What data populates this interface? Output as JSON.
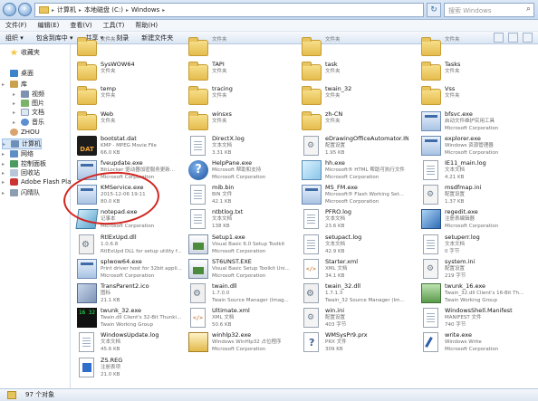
{
  "addressbar": {
    "crumbs": [
      "计算机",
      "本地磁盘 (C:)",
      "Windows"
    ],
    "search_placeholder": "搜索 Windows"
  },
  "menubar": [
    "文件(F)",
    "编辑(E)",
    "查看(V)",
    "工具(T)",
    "帮助(H)"
  ],
  "cmdbar": [
    "组织 ▾",
    "包含到库中 ▾",
    "共享 ▾",
    "刻录",
    "新建文件夹"
  ],
  "nav": [
    {
      "label": "收藏夹",
      "icon": "star-icon"
    },
    {
      "label": "桌面",
      "icon": "desktop-icon"
    },
    {
      "label": "库",
      "icon": "library-icon"
    },
    {
      "label": "视频",
      "icon": "video-icon"
    },
    {
      "label": "图片",
      "icon": "picture-icon"
    },
    {
      "label": "文档",
      "icon": "document-icon"
    },
    {
      "label": "音乐",
      "icon": "music-icon"
    },
    {
      "label": "ZHOU",
      "icon": "user-icon"
    },
    {
      "label": "计算机",
      "icon": "computer-icon"
    },
    {
      "label": "网络",
      "icon": "network-icon"
    },
    {
      "label": "控制面板",
      "icon": "control-panel-icon"
    },
    {
      "label": "回收站",
      "icon": "recycle-bin-icon"
    },
    {
      "label": "Adobe Flash Playe",
      "icon": "flash-icon"
    },
    {
      "label": "闪晴队",
      "icon": "drive-icon"
    }
  ],
  "files": [
    {
      "name": "",
      "line2": "文件夹",
      "line3": "",
      "icon": "folder-icon"
    },
    {
      "name": "",
      "line2": "文件夹",
      "line3": "",
      "icon": "folder-icon"
    },
    {
      "name": "",
      "line2": "文件夹",
      "line3": "",
      "icon": "folder-icon"
    },
    {
      "name": "",
      "line2": "文件夹",
      "line3": "",
      "icon": "folder-icon"
    },
    {
      "name": "SysWOW64",
      "line2": "文件夹",
      "line3": "",
      "icon": "folder-icon"
    },
    {
      "name": "TAPI",
      "line2": "文件夹",
      "line3": "",
      "icon": "folder-icon"
    },
    {
      "name": "task",
      "line2": "文件夹",
      "line3": "",
      "icon": "folder-icon"
    },
    {
      "name": "Tasks",
      "line2": "文件夹",
      "line3": "",
      "icon": "folder-icon"
    },
    {
      "name": "temp",
      "line2": "文件夹",
      "line3": "",
      "icon": "folder-icon"
    },
    {
      "name": "tracing",
      "line2": "文件夹",
      "line3": "",
      "icon": "folder-icon"
    },
    {
      "name": "twain_32",
      "line2": "文件夹",
      "line3": "",
      "icon": "folder-icon"
    },
    {
      "name": "Vss",
      "line2": "文件夹",
      "line3": "",
      "icon": "folder-icon"
    },
    {
      "name": "Web",
      "line2": "文件夹",
      "line3": "",
      "icon": "folder-icon"
    },
    {
      "name": "winsxs",
      "line2": "文件夹",
      "line3": "",
      "icon": "folder-icon"
    },
    {
      "name": "zh-CN",
      "line2": "文件夹",
      "line3": "",
      "icon": "folder-icon"
    },
    {
      "name": "bfsvc.exe",
      "line2": "启动文件维护实用工具",
      "line3": "Microsoft Corporation",
      "icon": "exe-icon"
    },
    {
      "name": "bootstat.dat",
      "line2": "KMP - MPEG Movie File",
      "line3": "66.0 KB",
      "icon": "dat-icon"
    },
    {
      "name": "DirectX.log",
      "line2": "文本文档",
      "line3": "3.31 KB",
      "icon": "text-file-icon"
    },
    {
      "name": "eDrawingOfficeAutomator.INI",
      "line2": "配置设置",
      "line3": "1.95 KB",
      "icon": "ini-icon"
    },
    {
      "name": "explorer.exe",
      "line2": "Windows 资源管理器",
      "line3": "Microsoft Corporation",
      "icon": "explorer-icon"
    },
    {
      "name": "fveupdate.exe",
      "line2": "BitLocker 驱动器加密服务更新...",
      "line3": "Microsoft Corporation",
      "icon": "exe-icon"
    },
    {
      "name": "HelpPane.exe",
      "line2": "Microsoft 帮助和支持",
      "line3": "Microsoft Corporation",
      "icon": "help-icon"
    },
    {
      "name": "hh.exe",
      "line2": "Microsoft® HTML 帮助可执行文件",
      "line3": "Microsoft Corporation",
      "icon": "help-file-icon"
    },
    {
      "name": "IE11_main.log",
      "line2": "文本文档",
      "line3": "4.21 KB",
      "icon": "text-file-icon"
    },
    {
      "name": "KMService.exe",
      "line2": "2015-12-06 19:11",
      "line3": "80.0 KB",
      "icon": "exe-icon"
    },
    {
      "name": "mib.bin",
      "line2": "BIN 文件",
      "line3": "42.1 KB",
      "icon": "bin-file-icon"
    },
    {
      "name": "MS_FM.exe",
      "line2": "Microsoft® Flash Working Set...",
      "line3": "Microsoft Corporation",
      "icon": "exe-icon"
    },
    {
      "name": "msdfmap.ini",
      "line2": "配置设置",
      "line3": "1.37 KB",
      "icon": "ini-icon"
    },
    {
      "name": "notepad.exe",
      "line2": "记事本",
      "line3": "Microsoft Corporation",
      "icon": "notepad-icon"
    },
    {
      "name": "ntbtlog.txt",
      "line2": "文本文档",
      "line3": "138 KB",
      "icon": "text-file-icon"
    },
    {
      "name": "PFRO.log",
      "line2": "文本文档",
      "line3": "23.6 KB",
      "icon": "text-file-icon"
    },
    {
      "name": "regedit.exe",
      "line2": "注册表编辑器",
      "line3": "Microsoft Corporation",
      "icon": "regedit-icon"
    },
    {
      "name": "RtlExUpd.dll",
      "line2": "1.0.6.8",
      "line3": "RtlExUpd DLL for setup utility f...",
      "icon": "dll-icon"
    },
    {
      "name": "Setup1.exe",
      "line2": "Visual Basic 6.0 Setup Toolkit",
      "line3": "Microsoft Corporation",
      "icon": "setup-icon"
    },
    {
      "name": "setupact.log",
      "line2": "文本文档",
      "line3": "42.9 KB",
      "icon": "text-file-icon"
    },
    {
      "name": "setuperr.log",
      "line2": "文本文档",
      "line3": "0 字节",
      "icon": "text-file-icon"
    },
    {
      "name": "splwow64.exe",
      "line2": "Print driver host for 32bit appli...",
      "line3": "Microsoft Corporation",
      "icon": "exe-icon"
    },
    {
      "name": "ST6UNST.EXE",
      "line2": "Visual Basic Setup Toolkit Uni...",
      "line3": "Microsoft Corporation",
      "icon": "setup-icon"
    },
    {
      "name": "Starter.xml",
      "line2": "XML 文档",
      "line3": "34.1 KB",
      "icon": "xml-icon"
    },
    {
      "name": "system.ini",
      "line2": "配置设置",
      "line3": "219 字节",
      "icon": "ini-icon"
    },
    {
      "name": "TransParent2.ico",
      "line2": "图标",
      "line3": "21.1 KB",
      "icon": "ico-file-icon"
    },
    {
      "name": "twain.dll",
      "line2": "1.7.0.0",
      "line3": "Twain Source Manager (Imag...",
      "icon": "dll-icon"
    },
    {
      "name": "twain_32.dll",
      "line2": "1.7.1.3",
      "line3": "Twain_32 Source Manager (Im...",
      "icon": "dll-icon"
    },
    {
      "name": "twunk_16.exe",
      "line2": "Twain_32.dll Client's 16-Bit Th...",
      "line3": "Twain Working Group",
      "icon": "twain-icon"
    },
    {
      "name": "twunk_32.exe",
      "line2": "Twain.dll Client's 32-Bit Thunki...",
      "line3": "Twain Working Group",
      "icon": "binary-icon"
    },
    {
      "name": "Ultimate.xml",
      "line2": "XML 文档",
      "line3": "50.6 KB",
      "icon": "xml-icon"
    },
    {
      "name": "win.ini",
      "line2": "配置设置",
      "line3": "403 字节",
      "icon": "ini-icon"
    },
    {
      "name": "WindowsShell.Manifest",
      "line2": "MANIFEST 文件",
      "line3": "740 字节",
      "icon": "manifest-icon"
    },
    {
      "name": "WindowsUpdate.log",
      "line2": "文本文档",
      "line3": "45.6 KB",
      "icon": "text-file-icon"
    },
    {
      "name": "winhlp32.exe",
      "line2": "Windows WinHlp32 占位程序",
      "line3": "Microsoft Corporation",
      "icon": "winhelp-icon"
    },
    {
      "name": "WMSysPr9.prx",
      "line2": "PRX 文件",
      "line3": "309 KB",
      "icon": "prx-icon"
    },
    {
      "name": "write.exe",
      "line2": "Windows Write",
      "line3": "Microsoft Corporation",
      "icon": "write-icon"
    },
    {
      "name": "ZS.REG",
      "line2": "注册表项",
      "line3": "21.0 KB",
      "icon": "reg-file-icon"
    }
  ],
  "status": {
    "count": "97 个对象"
  }
}
